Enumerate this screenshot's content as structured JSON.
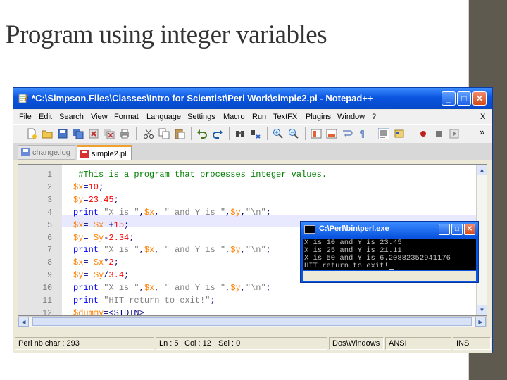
{
  "slide": {
    "title": "Program using integer variables"
  },
  "window": {
    "title": "*C:\\Simpson.Files\\Classes\\Intro for Scientist\\Perl Work\\simple2.pl - Notepad++",
    "min": "_",
    "max": "□",
    "close": "✕"
  },
  "menu": [
    "File",
    "Edit",
    "Search",
    "View",
    "Format",
    "Language",
    "Settings",
    "Macro",
    "Run",
    "TextFX",
    "Plugins",
    "Window",
    "?",
    "X"
  ],
  "toolbar": {
    "chevron": "»"
  },
  "tabs": [
    {
      "label": "change.log"
    },
    {
      "label": "simple2.pl"
    }
  ],
  "editor": {
    "lines": [
      {
        "num": "1",
        "parts": [
          {
            "t": " #This is a program that processes integer values.",
            "c": "#008000"
          }
        ]
      },
      {
        "num": "2",
        "parts": [
          {
            "t": "$x",
            "c": "#ff8000"
          },
          {
            "t": "=",
            "c": "#000080"
          },
          {
            "t": "10",
            "c": "#ff0000"
          },
          {
            "t": ";",
            "c": "#000080"
          }
        ]
      },
      {
        "num": "3",
        "parts": [
          {
            "t": "$y",
            "c": "#ff8000"
          },
          {
            "t": "=",
            "c": "#000080"
          },
          {
            "t": "23.45",
            "c": "#ff0000"
          },
          {
            "t": ";",
            "c": "#000080"
          }
        ]
      },
      {
        "num": "4",
        "parts": [
          {
            "t": "print",
            "c": "#0000ff"
          },
          {
            "t": " \"X is \"",
            "c": "#808080"
          },
          {
            "t": ",",
            "c": "#000080"
          },
          {
            "t": "$x",
            "c": "#ff8000"
          },
          {
            "t": ", ",
            "c": "#000080"
          },
          {
            "t": "\" and Y is \"",
            "c": "#808080"
          },
          {
            "t": ",",
            "c": "#000080"
          },
          {
            "t": "$y",
            "c": "#ff8000"
          },
          {
            "t": ",",
            "c": "#000080"
          },
          {
            "t": "\"\\n\"",
            "c": "#808080"
          },
          {
            "t": ";",
            "c": "#000080"
          }
        ]
      },
      {
        "num": "5",
        "parts": [
          {
            "t": "$x",
            "c": "#ff8000"
          },
          {
            "t": "= ",
            "c": "#000080"
          },
          {
            "t": "$x",
            "c": "#ff8000"
          },
          {
            "t": " +",
            "c": "#000080"
          },
          {
            "t": "15",
            "c": "#ff0000"
          },
          {
            "t": ";",
            "c": "#000080"
          }
        ]
      },
      {
        "num": "6",
        "parts": [
          {
            "t": "$y",
            "c": "#ff8000"
          },
          {
            "t": "= ",
            "c": "#000080"
          },
          {
            "t": "$y",
            "c": "#ff8000"
          },
          {
            "t": "-",
            "c": "#000080"
          },
          {
            "t": "2.34",
            "c": "#ff0000"
          },
          {
            "t": ";",
            "c": "#000080"
          }
        ]
      },
      {
        "num": "7",
        "parts": [
          {
            "t": "print",
            "c": "#0000ff"
          },
          {
            "t": " \"X is \"",
            "c": "#808080"
          },
          {
            "t": ",",
            "c": "#000080"
          },
          {
            "t": "$x",
            "c": "#ff8000"
          },
          {
            "t": ", ",
            "c": "#000080"
          },
          {
            "t": "\" and Y is \"",
            "c": "#808080"
          },
          {
            "t": ",",
            "c": "#000080"
          },
          {
            "t": "$y",
            "c": "#ff8000"
          },
          {
            "t": ",",
            "c": "#000080"
          },
          {
            "t": "\"\\n\"",
            "c": "#808080"
          },
          {
            "t": ";",
            "c": "#000080"
          }
        ]
      },
      {
        "num": "8",
        "parts": [
          {
            "t": "$x",
            "c": "#ff8000"
          },
          {
            "t": "= ",
            "c": "#000080"
          },
          {
            "t": "$x",
            "c": "#ff8000"
          },
          {
            "t": "*",
            "c": "#000080"
          },
          {
            "t": "2",
            "c": "#ff0000"
          },
          {
            "t": ";",
            "c": "#000080"
          }
        ]
      },
      {
        "num": "9",
        "parts": [
          {
            "t": "$y",
            "c": "#ff8000"
          },
          {
            "t": "= ",
            "c": "#000080"
          },
          {
            "t": "$y",
            "c": "#ff8000"
          },
          {
            "t": "/",
            "c": "#000080"
          },
          {
            "t": "3.4",
            "c": "#ff0000"
          },
          {
            "t": ";",
            "c": "#000080"
          }
        ]
      },
      {
        "num": "10",
        "parts": [
          {
            "t": "print",
            "c": "#0000ff"
          },
          {
            "t": " \"X is \"",
            "c": "#808080"
          },
          {
            "t": ",",
            "c": "#000080"
          },
          {
            "t": "$x",
            "c": "#ff8000"
          },
          {
            "t": ", ",
            "c": "#000080"
          },
          {
            "t": "\" and Y is \"",
            "c": "#808080"
          },
          {
            "t": ",",
            "c": "#000080"
          },
          {
            "t": "$y",
            "c": "#ff8000"
          },
          {
            "t": ",",
            "c": "#000080"
          },
          {
            "t": "\"\\n\"",
            "c": "#808080"
          },
          {
            "t": ";",
            "c": "#000080"
          }
        ]
      },
      {
        "num": "11",
        "parts": [
          {
            "t": "print",
            "c": "#0000ff"
          },
          {
            "t": " \"HIT return to exit!\"",
            "c": "#808080"
          },
          {
            "t": ";",
            "c": "#000080"
          }
        ]
      },
      {
        "num": "12",
        "parts": [
          {
            "t": "$dummy",
            "c": "#ff8000"
          },
          {
            "t": "=<STDIN>",
            "c": "#000080"
          }
        ]
      }
    ]
  },
  "status": {
    "chars": "Perl nb char : 293",
    "ln": "Ln : 5",
    "col": "Col : 12",
    "sel": "Sel : 0",
    "eol": "Dos\\Windows",
    "encoding": "ANSI",
    "mode": "INS"
  },
  "console": {
    "title": "C:\\Perl\\bin\\perl.exe",
    "lines": [
      "X is 10 and Y is 23.45",
      "X is 25 and Y is 21.11",
      "X is 50 and Y is 6.20882352941176",
      "HIT return to exit!"
    ]
  },
  "colors": {
    "titlebar": "#0a55e0",
    "gutter": "#e4e4e4",
    "current_line": "#e8e8ff",
    "tab_accent": "#f0a030"
  }
}
